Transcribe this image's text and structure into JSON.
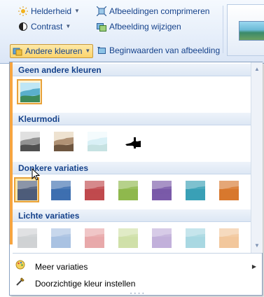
{
  "ribbon": {
    "brightness_label": "Helderheid",
    "compress_label": "Afbeeldingen comprimeren",
    "contrast_label": "Contrast",
    "change_picture_label": "Afbeelding wijzigen",
    "recolor_label": "Andere kleuren",
    "reset_label": "Beginwaarden van afbeelding"
  },
  "menu": {
    "sections": [
      {
        "title": "Geen andere kleuren"
      },
      {
        "title": "Kleurmodi"
      },
      {
        "title": "Donkere variaties"
      },
      {
        "title": "Lichte variaties"
      }
    ],
    "no_recolor_tiles": [
      {
        "style": "original",
        "selected": true
      }
    ],
    "color_modes": [
      {
        "style": "grayscale"
      },
      {
        "style": "sepia"
      },
      {
        "style": "washout"
      },
      {
        "style": "black-white"
      }
    ],
    "dark_variations": [
      {
        "color": "#4e5c7a"
      },
      {
        "color": "#3e6fb0"
      },
      {
        "color": "#c04a4e"
      },
      {
        "color": "#8fb84e"
      },
      {
        "color": "#7a5aa8"
      },
      {
        "color": "#3aa0b6"
      },
      {
        "color": "#d8782e"
      }
    ],
    "light_variations": [
      {
        "color": "#cfd2d4"
      },
      {
        "color": "#a9c2e2"
      },
      {
        "color": "#e8a8aa"
      },
      {
        "color": "#cfe0a8"
      },
      {
        "color": "#c2b0da"
      },
      {
        "color": "#a8d8e2"
      },
      {
        "color": "#f2c79c"
      }
    ],
    "more_variations_label": "Meer variaties",
    "set_transparent_label": "Doorzichtige kleur instellen"
  }
}
